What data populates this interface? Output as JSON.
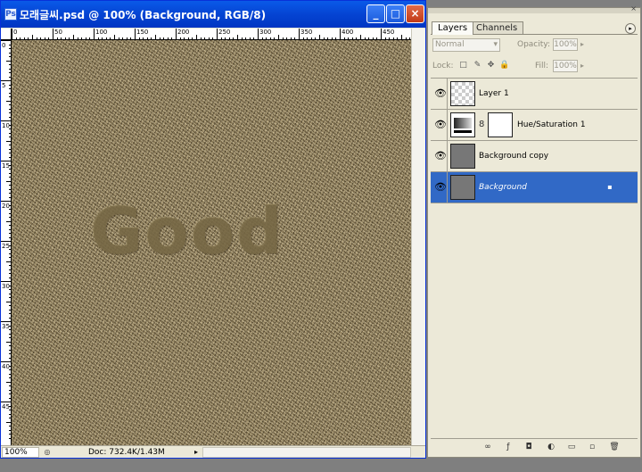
{
  "document": {
    "title": "모래글씨.psd @ 100% (Background, RGB/8)",
    "title_icon": "Ps",
    "zoom": "100%",
    "doc_info": "Doc: 732.4K/1.43M",
    "canvas_text": "Good",
    "ruler_top_labels": [
      "0",
      "50",
      "100",
      "150",
      "200",
      "250",
      "300",
      "350",
      "400",
      "450"
    ],
    "ruler_left_labels": [
      "0",
      "5",
      "10",
      "15",
      "20",
      "25",
      "30",
      "35",
      "40",
      "45"
    ],
    "window_buttons": {
      "minimize": "_",
      "maximize": "□",
      "close": "×"
    },
    "colors": {
      "titlebar": "#0544d3",
      "sand": "#8a7a57"
    }
  },
  "panel": {
    "tabs": {
      "layers": "Layers",
      "channels": "Channels"
    },
    "menu_glyph": "▸",
    "close_glyph": "×",
    "blend_mode": "Normal",
    "blend_arrow": "▾",
    "opacity_label": "Opacity:",
    "opacity_value": "100%",
    "lock_label": "Lock:",
    "fill_label": "Fill:",
    "fill_value": "100%",
    "arrow": "▸",
    "lock_icons": [
      "□",
      "✎",
      "✥",
      "🔒"
    ],
    "layers": [
      {
        "name": "Layer 1",
        "visible": true,
        "thumb": "transparent"
      },
      {
        "name": "Hue/Saturation 1",
        "visible": true,
        "thumb": "adjustment"
      },
      {
        "name": "Background copy",
        "visible": true,
        "thumb": "gray"
      },
      {
        "name": "Background",
        "visible": true,
        "thumb": "gray",
        "selected": true,
        "locked": true
      }
    ],
    "eye_glyph": "👁",
    "chain_glyph": "8",
    "lock_badge_glyph": "▪",
    "footer_icons": [
      "∞",
      "ƒ",
      "◘",
      "◐",
      "▭",
      "▫",
      "🗑"
    ],
    "colors": {
      "selected": "#3169c6",
      "panel_bg": "#ece9d8"
    }
  }
}
